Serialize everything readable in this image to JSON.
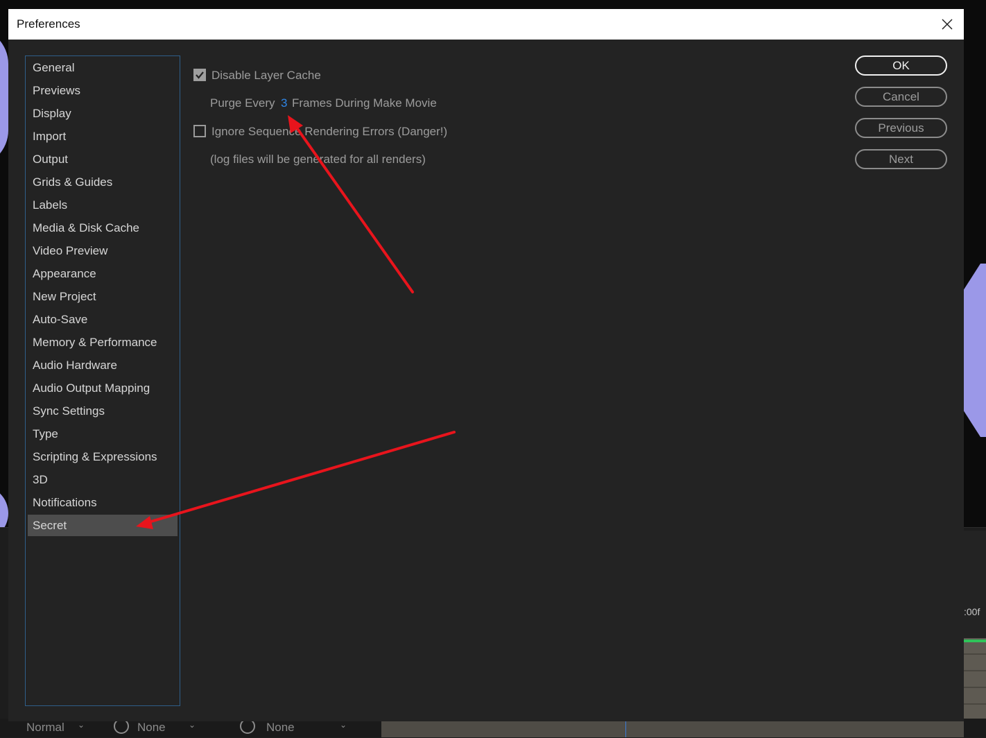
{
  "dialog": {
    "title": "Preferences"
  },
  "categories": [
    {
      "label": "General",
      "selected": false
    },
    {
      "label": "Previews",
      "selected": false
    },
    {
      "label": "Display",
      "selected": false
    },
    {
      "label": "Import",
      "selected": false
    },
    {
      "label": "Output",
      "selected": false
    },
    {
      "label": "Grids & Guides",
      "selected": false
    },
    {
      "label": "Labels",
      "selected": false
    },
    {
      "label": "Media & Disk Cache",
      "selected": false
    },
    {
      "label": "Video Preview",
      "selected": false
    },
    {
      "label": "Appearance",
      "selected": false
    },
    {
      "label": "New Project",
      "selected": false
    },
    {
      "label": "Auto-Save",
      "selected": false
    },
    {
      "label": "Memory & Performance",
      "selected": false
    },
    {
      "label": "Audio Hardware",
      "selected": false
    },
    {
      "label": "Audio Output Mapping",
      "selected": false
    },
    {
      "label": "Sync Settings",
      "selected": false
    },
    {
      "label": "Type",
      "selected": false
    },
    {
      "label": "Scripting & Expressions",
      "selected": false
    },
    {
      "label": "3D",
      "selected": false
    },
    {
      "label": "Notifications",
      "selected": false
    },
    {
      "label": "Secret",
      "selected": true
    }
  ],
  "options": {
    "disable_layer_cache": {
      "label": "Disable Layer Cache",
      "checked": true
    },
    "purge": {
      "prefix": "Purge Every",
      "value": "3",
      "suffix": "Frames During Make Movie"
    },
    "ignore_errors": {
      "label": "Ignore Sequence Rendering Errors (Danger!)",
      "checked": false
    },
    "note": "(log files will be generated for all renders)"
  },
  "buttons": {
    "ok": "OK",
    "cancel": "Cancel",
    "previous": "Previous",
    "next": "Next"
  },
  "background": {
    "timecode": ":00f",
    "blend_mode": "Normal",
    "parent_1": "None",
    "parent_2": "None"
  },
  "colors": {
    "annotation_arrow": "#e8141c",
    "accent_value": "#2f86e6",
    "list_border": "#2f5f8a"
  }
}
